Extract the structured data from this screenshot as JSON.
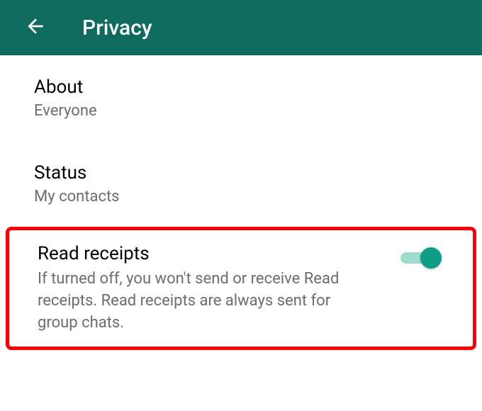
{
  "header": {
    "title": "Privacy"
  },
  "settings": {
    "about": {
      "title": "About",
      "value": "Everyone"
    },
    "status": {
      "title": "Status",
      "value": "My contacts"
    },
    "readReceipts": {
      "title": "Read receipts",
      "description": "If turned off, you won't send or receive Read receipts. Read receipts are always sent for group chats.",
      "enabled": true
    }
  },
  "colors": {
    "primary": "#0e6b5e",
    "accent": "#0e9e86",
    "highlight": "#ff0000"
  }
}
